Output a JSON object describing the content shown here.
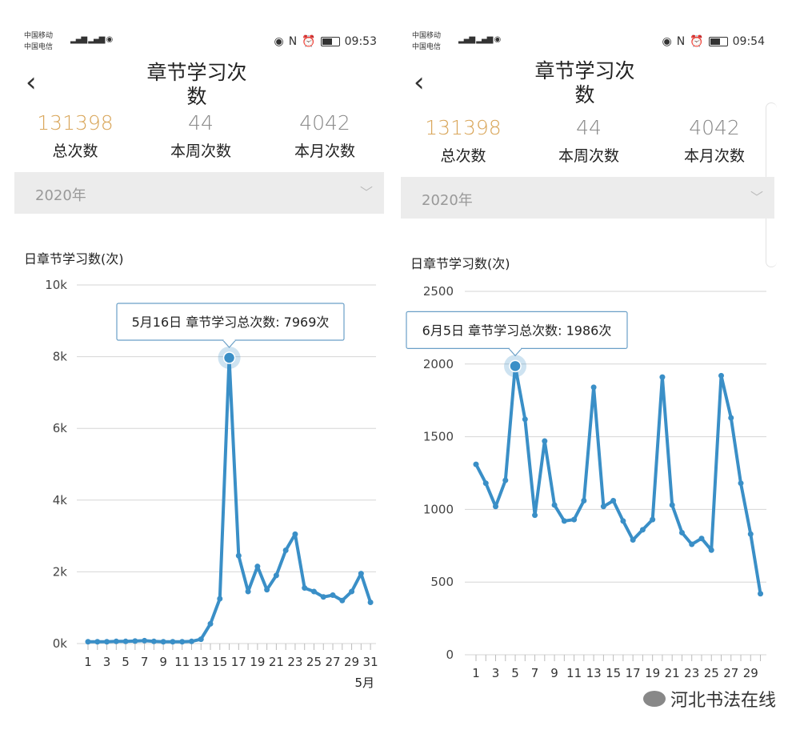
{
  "screens": [
    {
      "status": {
        "carrier1": "中国移动",
        "carrier2": "中国电信",
        "time": "09:53"
      },
      "title_line1": "章节学习次",
      "title_line2": "数",
      "stats": [
        {
          "value": "131398",
          "label": "总次数"
        },
        {
          "value": "44",
          "label": "本周次数"
        },
        {
          "value": "4042",
          "label": "本月次数"
        }
      ],
      "year": "2020年",
      "chart_title": "日章节学习数(次)",
      "tooltip": "5月16日 章节学习总次数: 7969次",
      "x_unit": "5月"
    },
    {
      "status": {
        "carrier1": "中国移动",
        "carrier2": "中国电信",
        "time": "09:54"
      },
      "title_line1": "章节学习次",
      "title_line2": "数",
      "stats": [
        {
          "value": "131398",
          "label": "总次数"
        },
        {
          "value": "44",
          "label": "本周次数"
        },
        {
          "value": "4042",
          "label": "本月次数"
        }
      ],
      "year": "2020年",
      "chart_title": "日章节学习数(次)",
      "tooltip": "6月5日 章节学习总次数: 1986次",
      "x_unit": ""
    }
  ],
  "watermark": "河北书法在线",
  "chart_data": [
    {
      "type": "line",
      "x": [
        1,
        2,
        3,
        4,
        5,
        6,
        7,
        8,
        9,
        10,
        11,
        12,
        13,
        14,
        15,
        16,
        17,
        18,
        19,
        20,
        21,
        22,
        23,
        24,
        25,
        26,
        27,
        28,
        29,
        30,
        31
      ],
      "series": [
        {
          "values": [
            50,
            50,
            50,
            60,
            60,
            70,
            80,
            60,
            50,
            50,
            50,
            60,
            120,
            550,
            1250,
            7969,
            2450,
            1450,
            2150,
            1500,
            1900,
            2600,
            3050,
            1550,
            1450,
            1300,
            1350,
            1200,
            1450,
            1950,
            1150
          ]
        }
      ],
      "yticks": [
        "0k",
        "2k",
        "4k",
        "6k",
        "8k",
        "10k"
      ],
      "xtick_labels": [
        "1",
        "3",
        "5",
        "7",
        "9",
        "11",
        "13",
        "15",
        "17",
        "19",
        "21",
        "23",
        "25",
        "27",
        "29",
        "31"
      ],
      "ylim": [
        0,
        10000
      ],
      "color": "#3a8fc7",
      "highlight_x": 16
    },
    {
      "type": "line",
      "x": [
        1,
        2,
        3,
        4,
        5,
        6,
        7,
        8,
        9,
        10,
        11,
        12,
        13,
        14,
        15,
        16,
        17,
        18,
        19,
        20,
        21,
        22,
        23,
        24,
        25,
        26,
        27,
        28,
        29,
        30
      ],
      "series": [
        {
          "values": [
            1310,
            1180,
            1020,
            1200,
            1986,
            1620,
            960,
            1470,
            1030,
            920,
            930,
            1060,
            1840,
            1020,
            1060,
            920,
            790,
            860,
            930,
            1910,
            1030,
            840,
            760,
            800,
            720,
            1920,
            1630,
            1180,
            830,
            420
          ]
        }
      ],
      "yticks": [
        "0",
        "500",
        "1000",
        "1500",
        "2000",
        "2500"
      ],
      "xtick_labels": [
        "1",
        "3",
        "5",
        "7",
        "9",
        "11",
        "13",
        "15",
        "17",
        "19",
        "21",
        "23",
        "25",
        "27",
        "29"
      ],
      "ylim": [
        0,
        2500
      ],
      "color": "#3a8fc7",
      "highlight_x": 5
    }
  ]
}
